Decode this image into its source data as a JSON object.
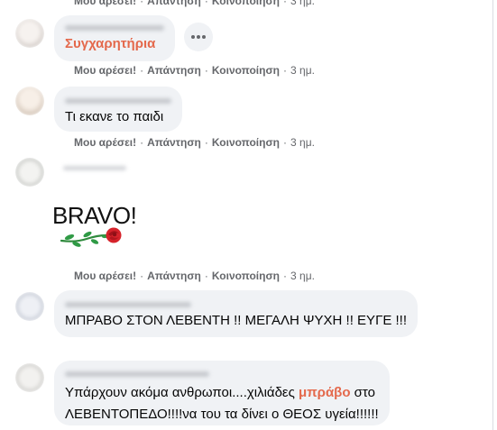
{
  "actions": {
    "like": "Μου αρέσει!",
    "reply": "Απάντηση",
    "share": "Κοινοποίηση",
    "separator": "·",
    "time": "3 ημ."
  },
  "comments": [
    {
      "text": "Συγχαρητήρια",
      "highlighted": true
    },
    {
      "text": "Τι εκανε το παιδι"
    },
    {
      "sticker_text": "BRAVO!",
      "sticker_icon": "rose-icon"
    },
    {
      "text": "ΜΠΡΑΒΟ ΣΤΟΝ ΛΕΒΕΝΤΗ !! ΜΕΓΑΛΗ ΨΥΧΗ !! ΕΥΓΕ !!!"
    },
    {
      "line1_before": "Υπάρχουν ακόμα ανθρωποι....χιλιάδες ",
      "line1_highlight": "μπράβο",
      "line1_after": " στο",
      "line2": "ΛΕΒΕΝΤΟΠΕΔΟ!!!!να του τα δίνει ο ΘΕΟΣ υγεία!!!!!!"
    }
  ],
  "more_options": {
    "icon": "more-horizontal-icon"
  },
  "colors": {
    "bubble": "#f0f2f5",
    "text": "#050505",
    "meta": "#65676b",
    "highlight": "#e4694c"
  }
}
